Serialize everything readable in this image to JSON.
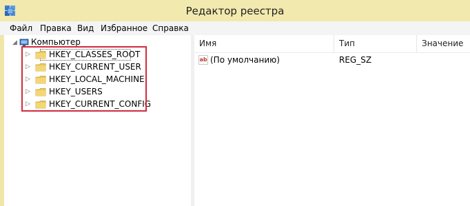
{
  "window": {
    "title": "Редактор реестра"
  },
  "menu": [
    {
      "label": "Файл"
    },
    {
      "label": "Правка"
    },
    {
      "label": "Вид"
    },
    {
      "label": "Избранное"
    },
    {
      "label": "Справка"
    }
  ],
  "tree": {
    "root": {
      "label": "Компьютер",
      "icon": "computer-icon"
    },
    "items": [
      {
        "label": "HKEY_CLASSES_ROOT",
        "selected": true
      },
      {
        "label": "HKEY_CURRENT_USER"
      },
      {
        "label": "HKEY_LOCAL_MACHINE"
      },
      {
        "label": "HKEY_USERS"
      },
      {
        "label": "HKEY_CURRENT_CONFIG"
      }
    ]
  },
  "list": {
    "columns": [
      {
        "label": "Имя"
      },
      {
        "label": "Тип"
      },
      {
        "label": "Значение"
      }
    ],
    "rows": [
      {
        "name": "(По умолчанию)",
        "type": "REG_SZ",
        "value": "",
        "icon": "string-value-icon"
      }
    ]
  },
  "colors": {
    "titlebar": "#f2e9ae",
    "highlight": "#d22a3a"
  }
}
